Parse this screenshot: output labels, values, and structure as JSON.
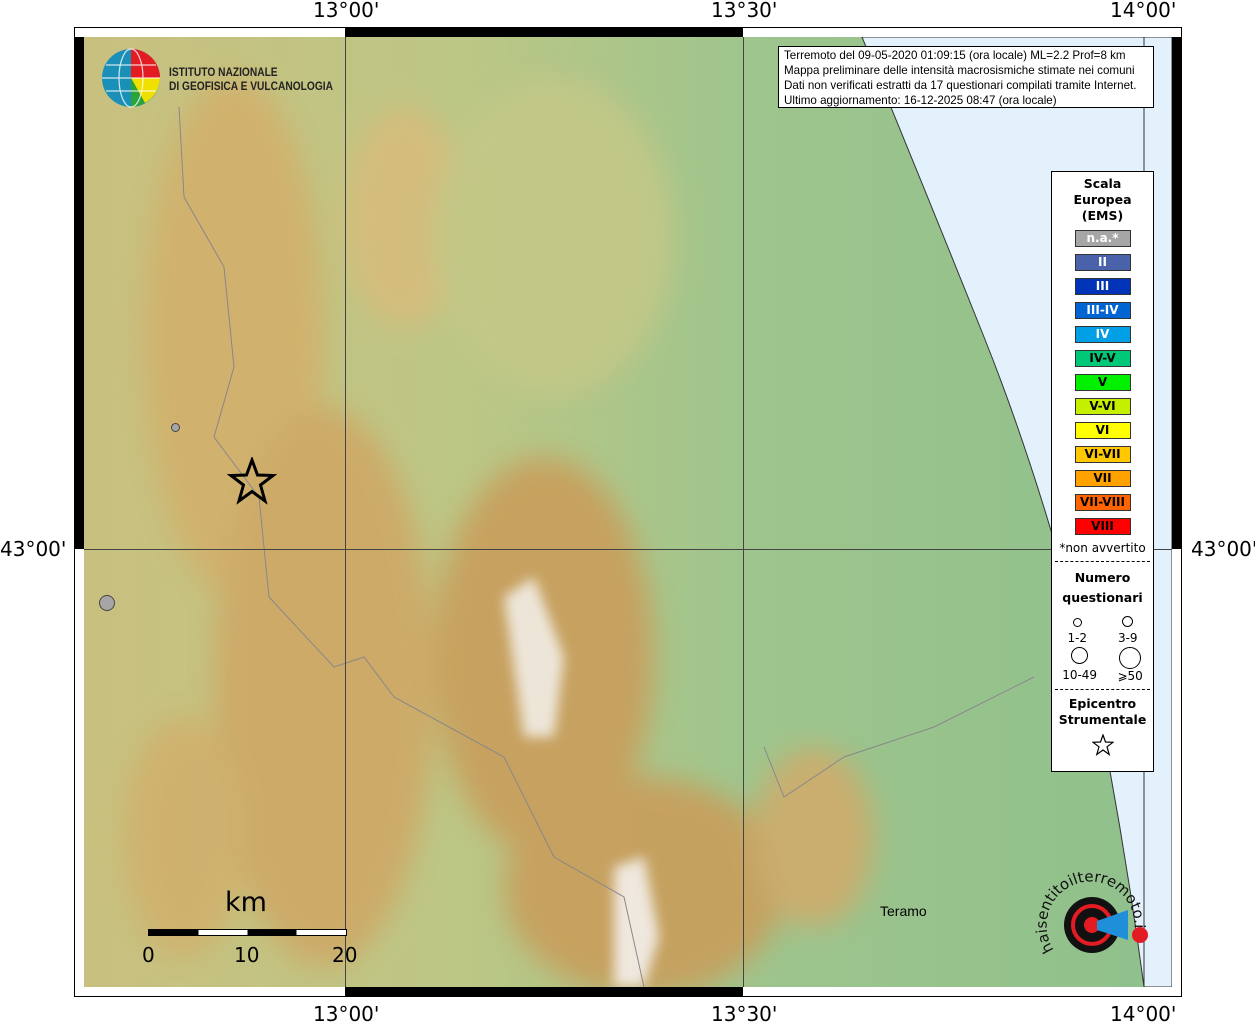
{
  "axes": {
    "lon_ticks": [
      "13°00'",
      "13°30'",
      "14°00'"
    ],
    "lat_ticks": [
      "43°00'"
    ]
  },
  "logo_ingv": {
    "line1": "ISTITUTO NAZIONALE",
    "line2": "DI GEOFISICA E VULCANOLOGIA"
  },
  "info": {
    "line1": "Terremoto del 09-05-2020 01:09:15 (ora locale) ML=2.2 Prof=8 km",
    "line2": "Mappa preliminare delle intensità macrosismiche stimate nei comuni",
    "line3": "Dati non verificati estratti da 17 questionari compilati tramite Internet.",
    "line4": "Ultimo aggiornamento: 16-12-2025 08:47 (ora locale)"
  },
  "legend": {
    "title_lines": [
      "Scala",
      "Europea",
      "(EMS)"
    ],
    "scale": [
      {
        "label": "n.a.*",
        "color": "#a6a6a6",
        "text": "#ffffff"
      },
      {
        "label": "II",
        "color": "#4a62aa",
        "text": "#ffffff"
      },
      {
        "label": "III",
        "color": "#0033b8",
        "text": "#ffffff"
      },
      {
        "label": "III-IV",
        "color": "#0064d2",
        "text": "#ffffff"
      },
      {
        "label": "IV",
        "color": "#009fe6",
        "text": "#ffffff"
      },
      {
        "label": "IV-V",
        "color": "#00c878",
        "text": "#000000"
      },
      {
        "label": "V",
        "color": "#00f000",
        "text": "#000000"
      },
      {
        "label": "V-VI",
        "color": "#c4f000",
        "text": "#000000"
      },
      {
        "label": "VI",
        "color": "#ffff00",
        "text": "#000000"
      },
      {
        "label": "VI-VII",
        "color": "#ffc800",
        "text": "#000000"
      },
      {
        "label": "VII",
        "color": "#ffa200",
        "text": "#000000"
      },
      {
        "label": "VII-VIII",
        "color": "#ff6400",
        "text": "#000000"
      },
      {
        "label": "VIII",
        "color": "#ff0000",
        "text": "#000000"
      }
    ],
    "note": "*non avvertito",
    "count_title_lines": [
      "Numero",
      "questionari"
    ],
    "counts": [
      "1-2",
      "3-9",
      "10-49",
      "⩾50"
    ],
    "epicenter_lines": [
      "Epicentro",
      "Strumentale"
    ]
  },
  "places": {
    "teramo": "Teramo"
  },
  "scalebar": {
    "unit": "km",
    "labels": [
      "0",
      "10",
      "20"
    ]
  },
  "logo_hsit": {
    "text": "www.haisentitoilterremoto.it"
  },
  "colors": {
    "sea": "#e2f1fb",
    "lowland": "#a8c88a",
    "mountain": "#c9a263"
  }
}
